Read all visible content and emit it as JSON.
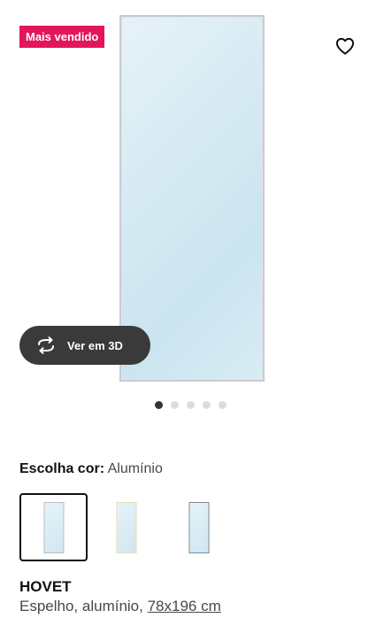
{
  "product": {
    "badge": "Mais vendido",
    "name": "HOVET",
    "description_prefix": "Espelho, alumínio, ",
    "size_link": "78x196 cm"
  },
  "gallery": {
    "view_3d_label": "Ver em 3D",
    "dot_count": 5,
    "active_index": 0,
    "favorite_icon": "heart-outline-icon",
    "view_3d_icon": "rotate-360-icon"
  },
  "color": {
    "label": "Escolha cor:",
    "selected": "Alumínio",
    "options": [
      {
        "frame_color": "#b9bec3"
      },
      {
        "frame_color": "#ecdcb0"
      },
      {
        "frame_color": "#7f8a96"
      }
    ]
  },
  "colors": {
    "badge_bg": "#e3165b",
    "pill_bg": "#3a3a3a",
    "dot_active": "#333333",
    "dot_inactive": "#dcdcdc"
  }
}
